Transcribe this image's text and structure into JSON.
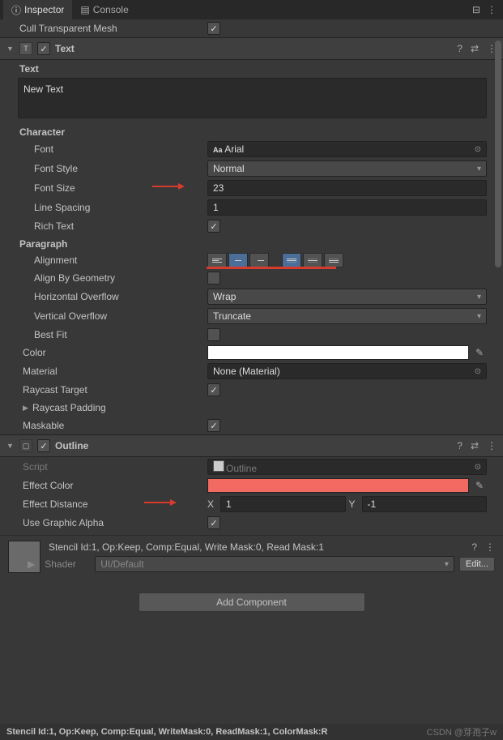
{
  "tabs": {
    "inspector": "Inspector",
    "console": "Console"
  },
  "cull_transparent": "Cull Transparent Mesh",
  "text_comp": {
    "title": "Text",
    "text_label": "Text",
    "text_value": "New Text",
    "character": "Character",
    "font_label": "Font",
    "font_value": "Arial",
    "font_style_label": "Font Style",
    "font_style_value": "Normal",
    "font_size_label": "Font Size",
    "font_size_value": "23",
    "line_spacing_label": "Line Spacing",
    "line_spacing_value": "1",
    "rich_text": "Rich Text",
    "paragraph": "Paragraph",
    "alignment": "Alignment",
    "align_by_geom": "Align By Geometry",
    "h_overflow_label": "Horizontal Overflow",
    "h_overflow_value": "Wrap",
    "v_overflow_label": "Vertical Overflow",
    "v_overflow_value": "Truncate",
    "best_fit": "Best Fit",
    "color_label": "Color",
    "material_label": "Material",
    "material_value": "None (Material)",
    "raycast_target": "Raycast Target",
    "raycast_padding": "Raycast Padding",
    "maskable": "Maskable"
  },
  "outline_comp": {
    "title": "Outline",
    "script_label": "Script",
    "script_value": "Outline",
    "effect_color_label": "Effect Color",
    "effect_color_value": "#f26a62",
    "effect_distance_label": "Effect Distance",
    "x": "X",
    "x_val": "1",
    "y": "Y",
    "y_val": "-1",
    "use_alpha": "Use Graphic Alpha"
  },
  "material": {
    "summary": "Stencil Id:1, Op:Keep, Comp:Equal, Write Mask:0, Read Mask:1",
    "shader_label": "Shader",
    "shader_value": "UI/Default",
    "edit": "Edit..."
  },
  "add_component": "Add Component",
  "footer": "Stencil Id:1, Op:Keep, Comp:Equal, WriteMask:0, ReadMask:1, ColorMask:R",
  "watermark": "CSDN @芽孢子w"
}
